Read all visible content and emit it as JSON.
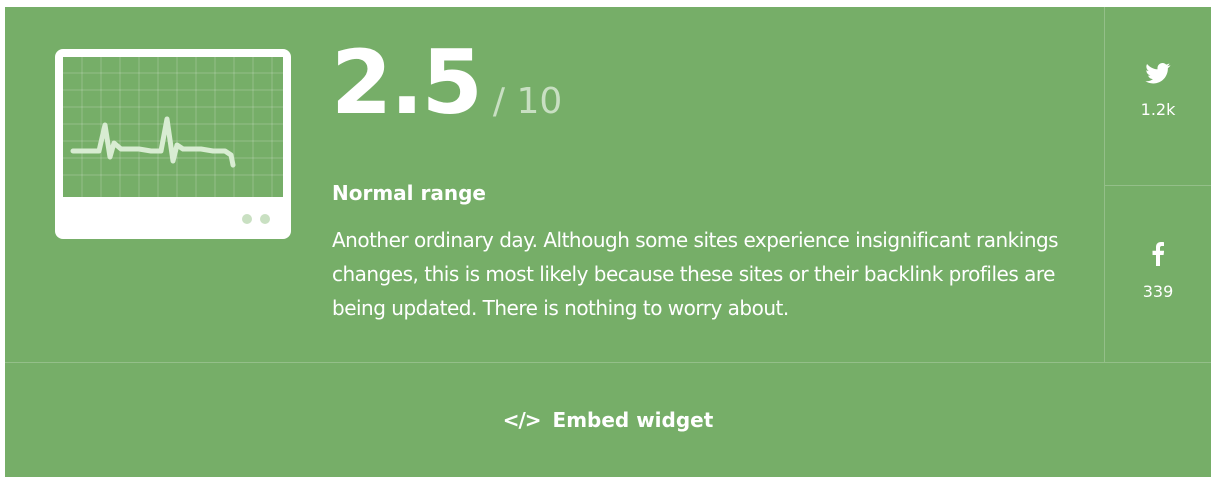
{
  "score": {
    "value": "2.5",
    "max": "/ 10"
  },
  "status": {
    "title": "Normal range",
    "description": "Another ordinary day. Although some sites experience insignificant rankings changes, this is most likely because these sites or their backlink profiles are being updated. There is nothing to worry about."
  },
  "share": {
    "twitter": {
      "icon": "twitter-icon",
      "count": "1.2k"
    },
    "facebook": {
      "icon": "facebook-icon",
      "count": "339"
    }
  },
  "embed": {
    "icon": "code-icon",
    "icon_text": "</>",
    "label": "Embed widget"
  },
  "colors": {
    "background": "#76ae68",
    "text": "#ffffff",
    "pulse_line": "#d8ecd2"
  }
}
